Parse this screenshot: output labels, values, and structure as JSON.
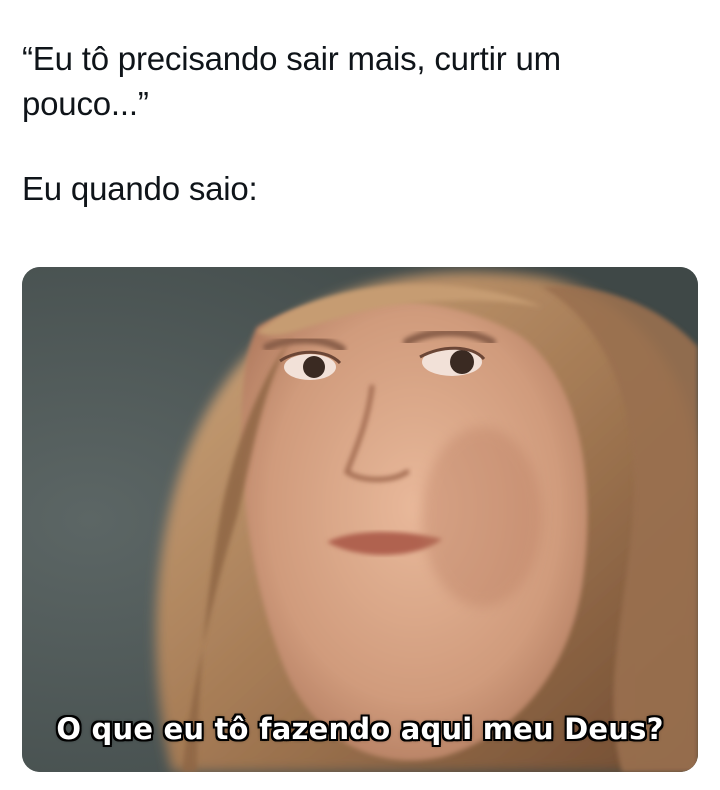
{
  "post": {
    "quote_line": "“Eu tô precisando sair mais, curtir um pouco...”",
    "reaction_line": "Eu quando saio:"
  },
  "media": {
    "subtitle": "O que eu tô fazendo aqui meu Deus?",
    "colors": {
      "background_wall": "#4e5757",
      "hair": "#b08660",
      "skin": "#d9a688",
      "subtitle_text": "#ffffff",
      "subtitle_outline": "#000000"
    }
  }
}
